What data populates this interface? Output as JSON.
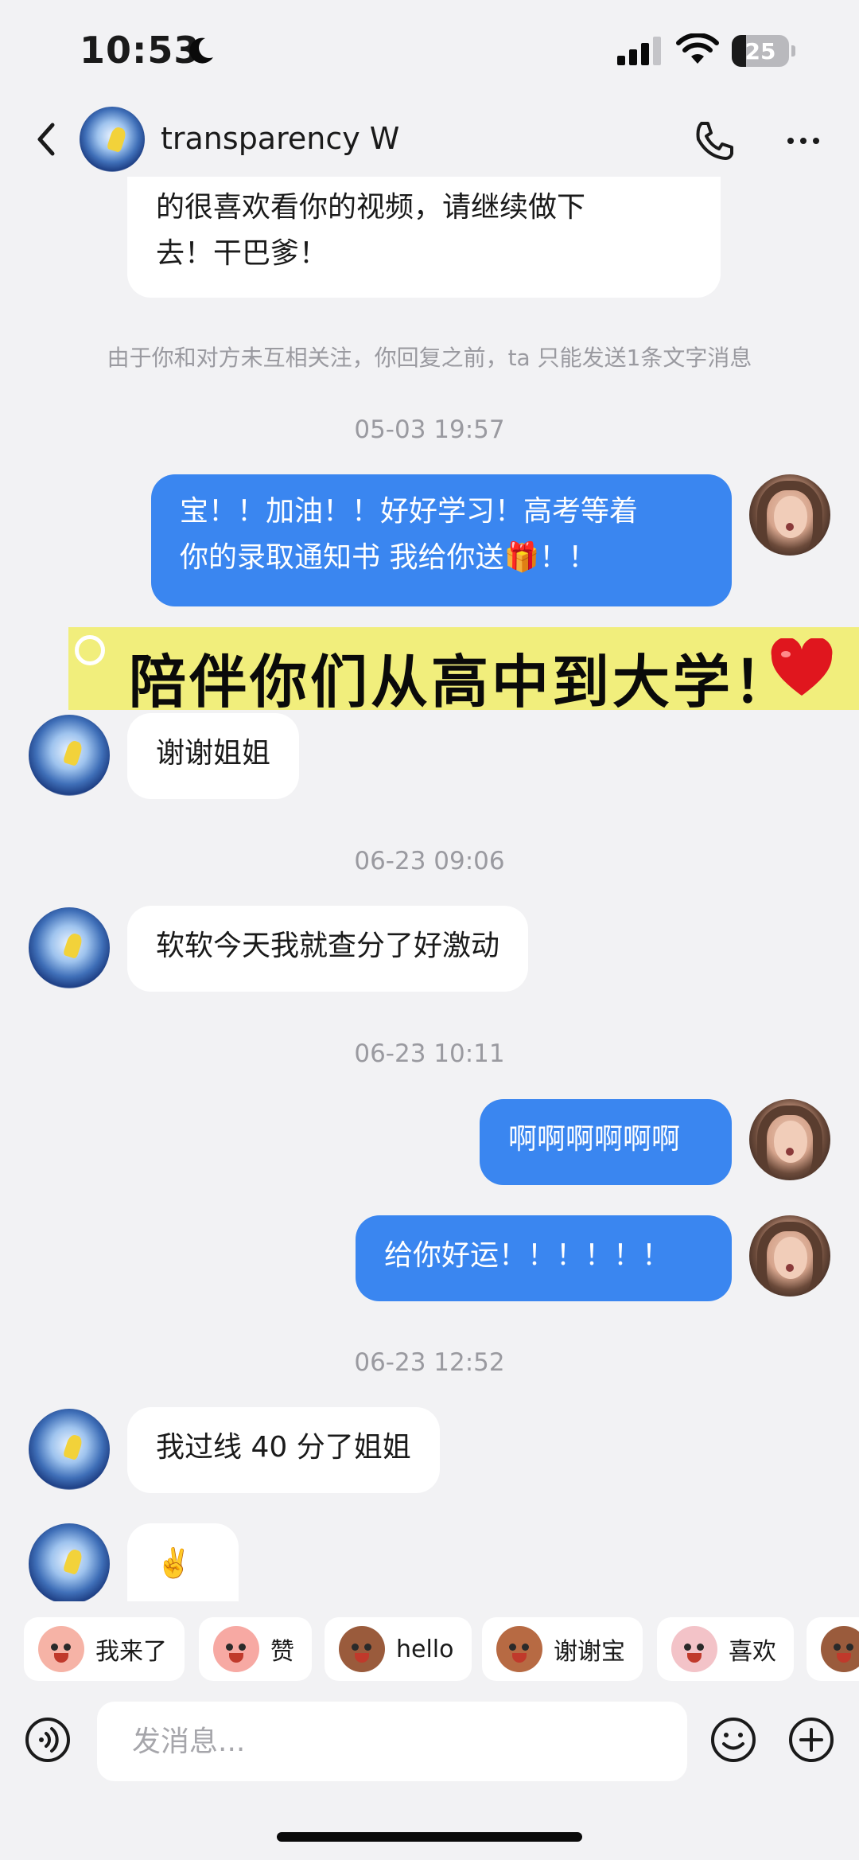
{
  "status_bar": {
    "time": "10:53",
    "battery_level": "25",
    "icons": [
      "moon-icon",
      "signal-icon",
      "wifi-icon",
      "battery-icon"
    ]
  },
  "header": {
    "contact_name": "transparency  W",
    "icons": [
      "chevron-left-icon",
      "phone-icon",
      "more-icon"
    ]
  },
  "messages": [
    {
      "id": "m1",
      "side": "in",
      "text": "的很喜欢看你的视频，请继续做下\n去！干巴爹！"
    },
    {
      "id": "notice",
      "type": "notice",
      "text": "由于你和对方未互相关注，你回复之前，ta 只能发送1条文字消息"
    },
    {
      "id": "t1",
      "type": "time",
      "text": "05-03 19:57"
    },
    {
      "id": "m2",
      "side": "out",
      "text": "宝！！加油！！好好学习！高考等着\n你的录取通知书 我给你送🎁！！"
    },
    {
      "id": "m3",
      "side": "in",
      "text": "谢谢姐姐"
    },
    {
      "id": "t2",
      "type": "time",
      "text": "06-23 09:06"
    },
    {
      "id": "m4",
      "side": "in",
      "text": "软软今天我就查分了好激动"
    },
    {
      "id": "t3",
      "type": "time",
      "text": "06-23 10:11"
    },
    {
      "id": "m5",
      "side": "out",
      "text": "啊啊啊啊啊啊"
    },
    {
      "id": "m6",
      "side": "out",
      "text": "给你好运！！！！！！"
    },
    {
      "id": "t4",
      "type": "time",
      "text": "06-23 12:52"
    },
    {
      "id": "m7",
      "side": "in",
      "text": "我过线 40 分了姐姐"
    },
    {
      "id": "m8",
      "side": "in",
      "text": "✌️"
    }
  ],
  "banner": {
    "text": "陪伴你们从高中到大学！",
    "accent_color": "#f1ee7c"
  },
  "quick_replies": [
    {
      "label": "我来了",
      "emoji_color": "#f6b3a6"
    },
    {
      "label": "赞",
      "emoji_color": "#f7a9a3"
    },
    {
      "label": "hello",
      "emoji_color": "#9a5b3c"
    },
    {
      "label": "谢谢宝",
      "emoji_color": "#b76a43"
    },
    {
      "label": "喜欢",
      "emoji_color": "#f3c3c8"
    }
  ],
  "input": {
    "placeholder": "发消息..."
  },
  "colors": {
    "background": "#f2f2f4",
    "outgoing_bubble": "#3a86f0",
    "incoming_bubble": "#ffffff"
  }
}
